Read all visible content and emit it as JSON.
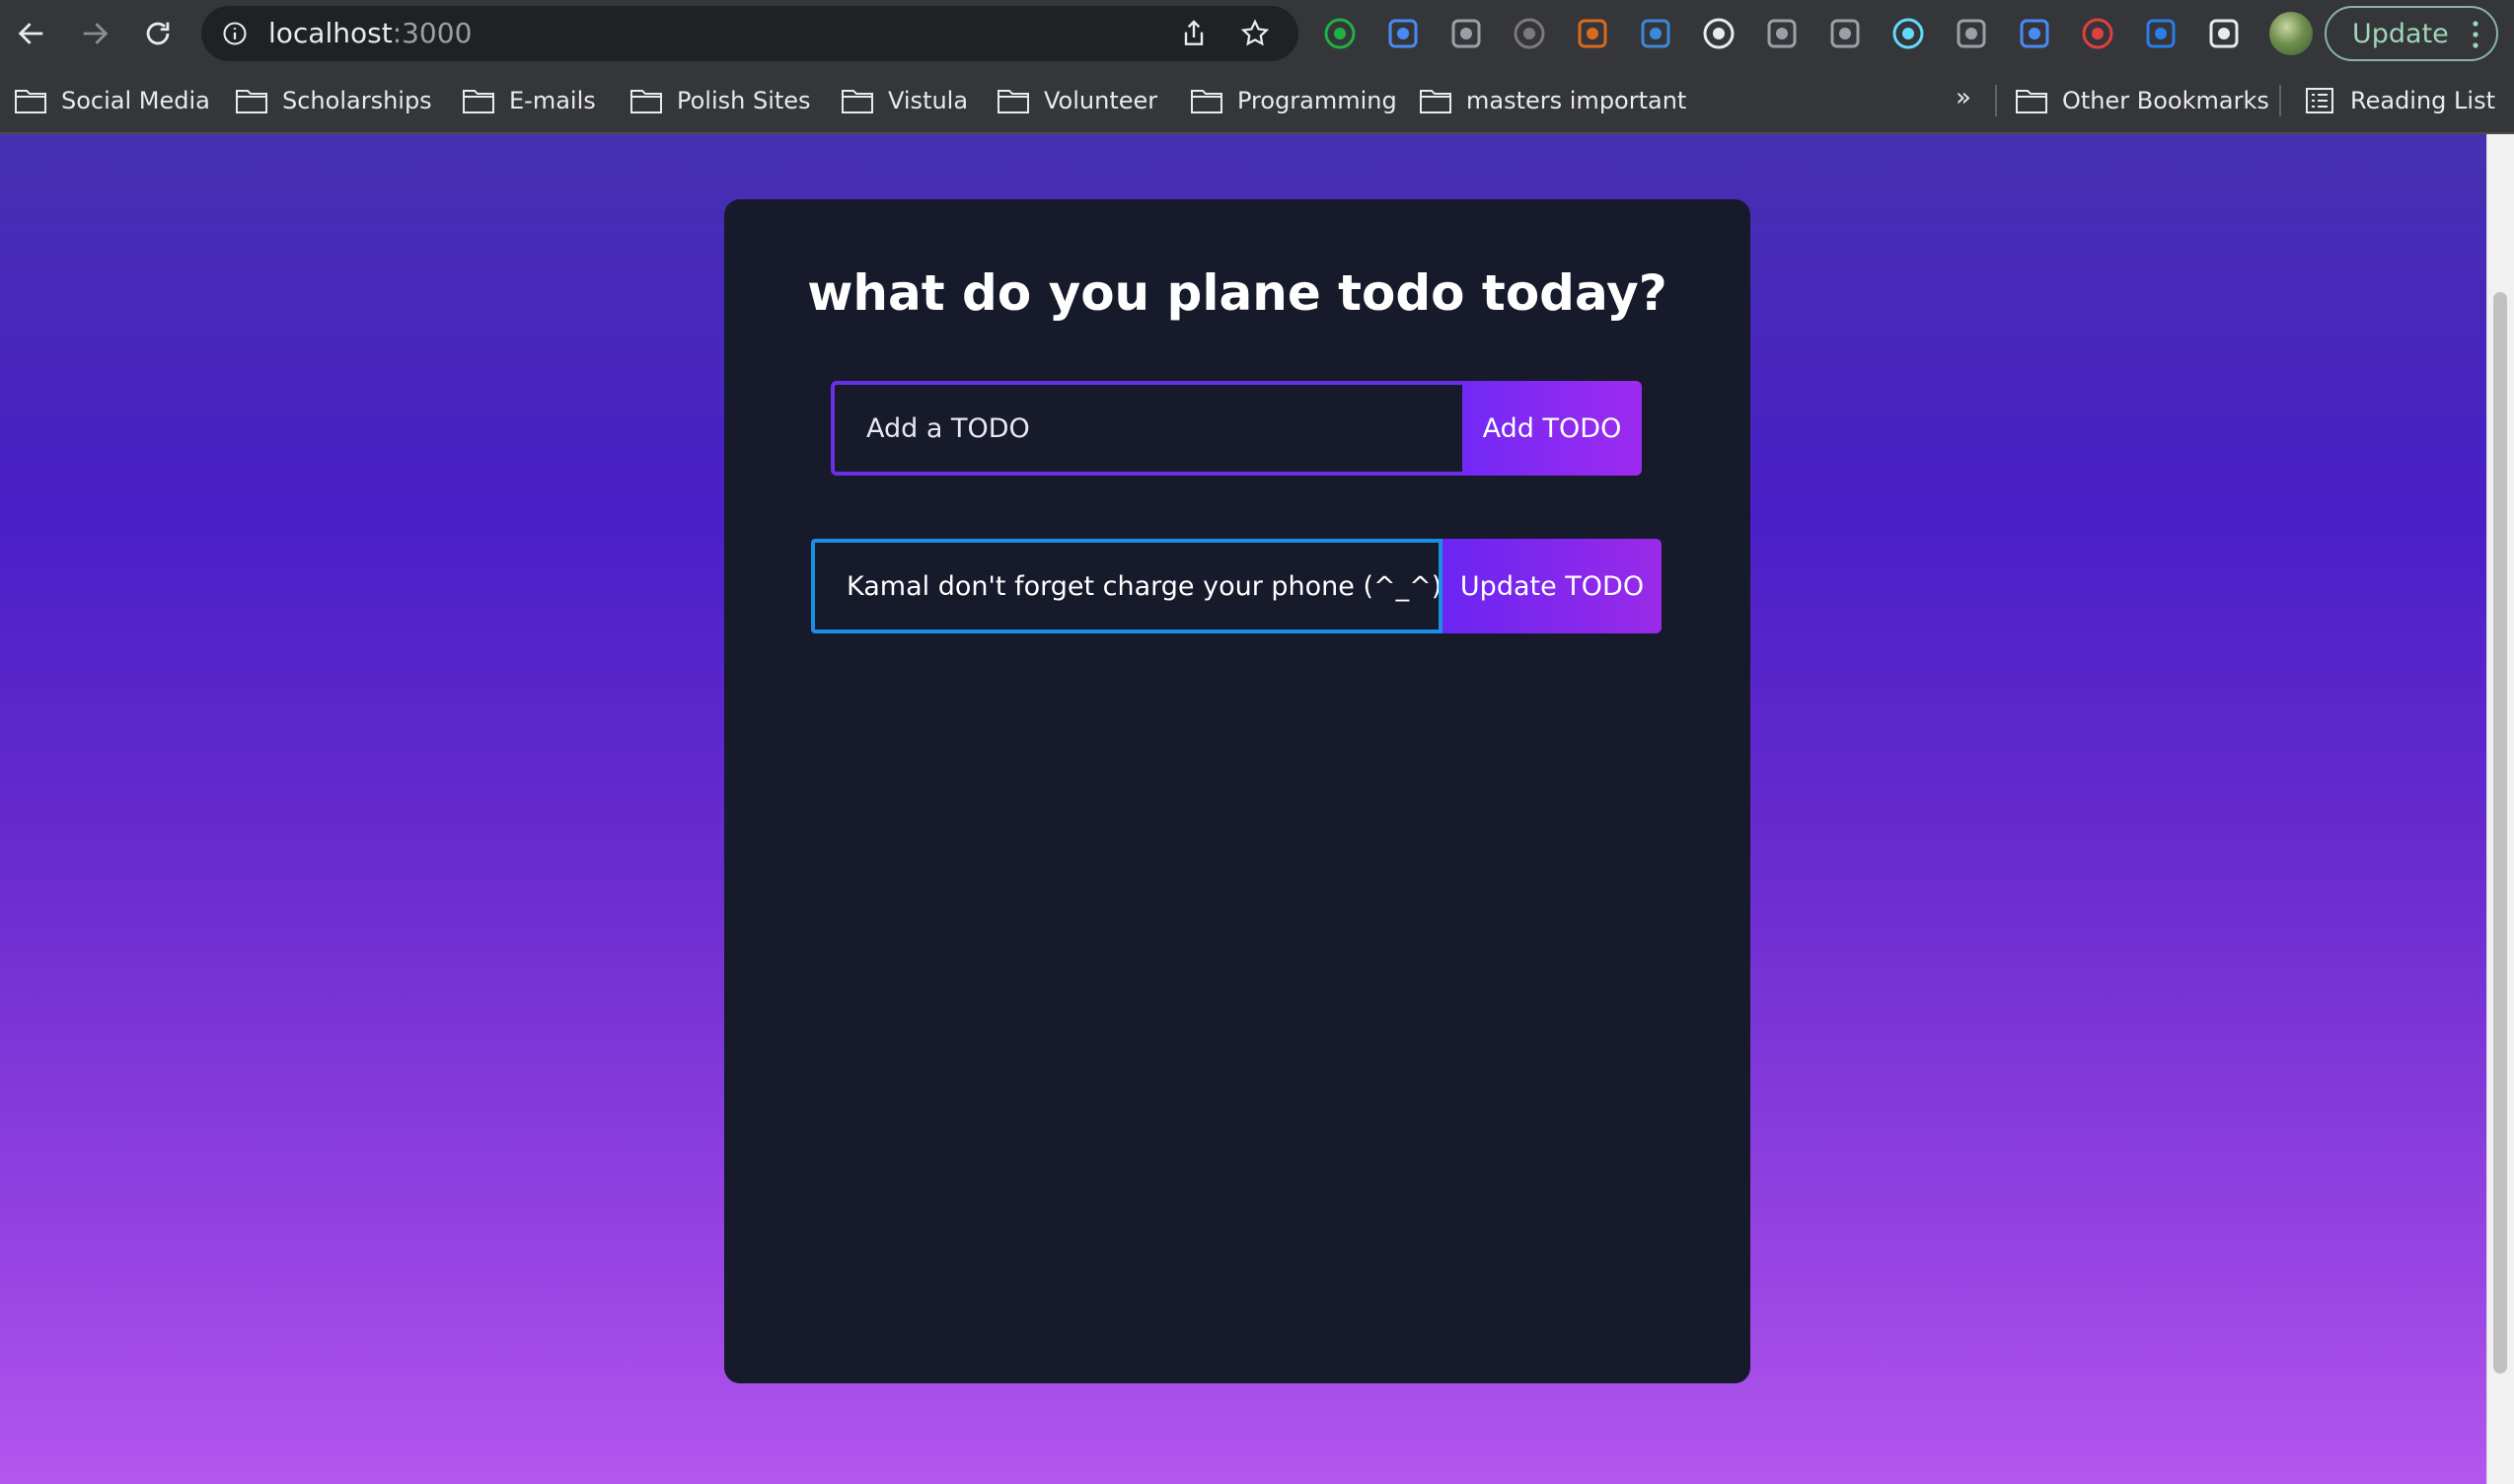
{
  "browser": {
    "url_host": "localhost",
    "url_port": ":3000",
    "update_label": "Update",
    "extensions": [
      {
        "icon": "thumbs-up-icon",
        "color": "#1fb141"
      },
      {
        "icon": "google-translate-icon",
        "color": "#4a8af4"
      },
      {
        "icon": "cloud-icon",
        "color": "#9aa0a6"
      },
      {
        "icon": "json-viewer-icon",
        "color": "#7a7a7a"
      },
      {
        "icon": "puzzle-pieces-icon",
        "color": "#d86a1f"
      },
      {
        "icon": "fi-icon",
        "color": "#3b8ad9"
      },
      {
        "icon": "reader-icon",
        "color": "#e8eaed"
      },
      {
        "icon": "camera-icon",
        "color": "#9aa0a6"
      },
      {
        "icon": "vue-devtools-icon",
        "color": "#9aa0a6"
      },
      {
        "icon": "react-devtools-icon",
        "color": "#61dafb"
      },
      {
        "icon": "target-icon",
        "color": "#9aa0a6"
      },
      {
        "icon": "edit-pencil-icon",
        "color": "#4a8af4"
      },
      {
        "icon": "redux-icon",
        "color": "#e0403f"
      },
      {
        "icon": "shield-icon",
        "color": "#2b7de9"
      },
      {
        "icon": "extensions-puzzle-icon",
        "color": "#e8eaed"
      }
    ]
  },
  "bookmarks": {
    "items": [
      "Social Media",
      "Scholarships",
      "E-mails",
      "Polish Sites",
      "Vistula",
      "Volunteer",
      "Programming",
      "masters important"
    ],
    "more": "»",
    "other": "Other Bookmarks",
    "reading_list": "Reading List"
  },
  "app": {
    "title": "what do you plane todo today?",
    "add_placeholder": "Add a TODO",
    "add_button": "Add TODO",
    "edit_value": "Kamal don't forget charge your phone (^_^)",
    "update_button": "Update TODO"
  },
  "colors": {
    "card_bg": "#161a2b",
    "add_border": "#6b2fe6",
    "edit_border": "#1a8ee0",
    "button_gradient_start": "#7129f5",
    "button_gradient_end": "#9e2af0"
  }
}
